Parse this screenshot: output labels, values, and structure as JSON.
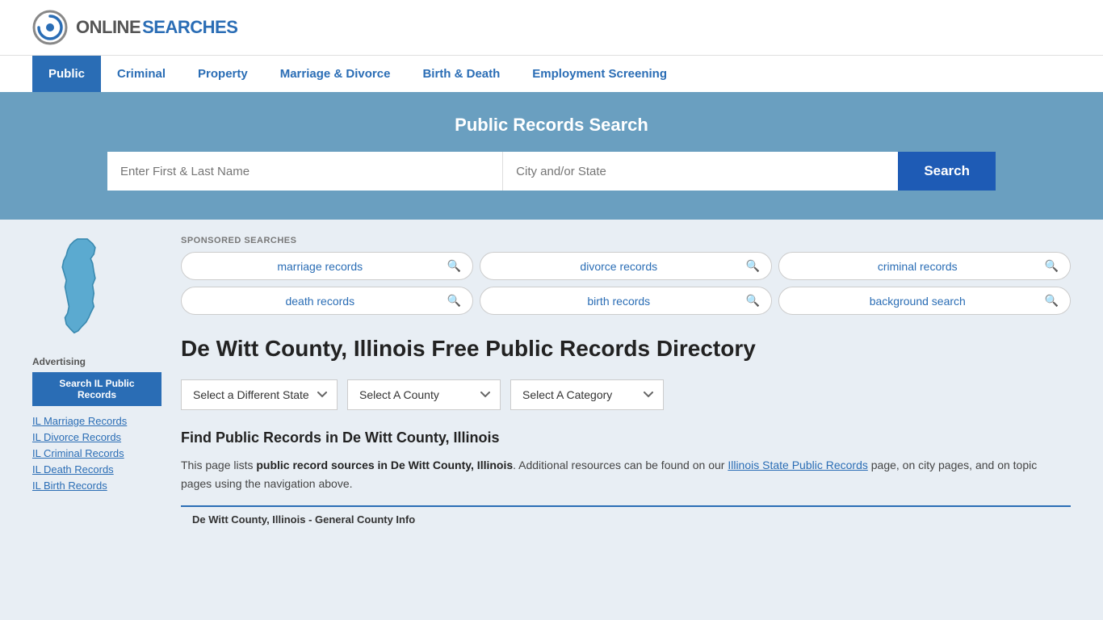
{
  "logo": {
    "online": "ONLINE",
    "searches": "SEARCHES"
  },
  "nav": {
    "items": [
      {
        "label": "Public",
        "active": true
      },
      {
        "label": "Criminal",
        "active": false
      },
      {
        "label": "Property",
        "active": false
      },
      {
        "label": "Marriage & Divorce",
        "active": false
      },
      {
        "label": "Birth & Death",
        "active": false
      },
      {
        "label": "Employment Screening",
        "active": false
      }
    ]
  },
  "hero": {
    "title": "Public Records Search",
    "name_placeholder": "Enter First & Last Name",
    "location_placeholder": "City and/or State",
    "search_button": "Search"
  },
  "sponsored": {
    "label": "SPONSORED SEARCHES",
    "items": [
      "marriage records",
      "divorce records",
      "criminal records",
      "death records",
      "birth records",
      "background search"
    ]
  },
  "page": {
    "title": "De Witt County, Illinois Free Public Records Directory",
    "dropdowns": {
      "state": "Select a Different State",
      "county": "Select A County",
      "category": "Select A Category"
    },
    "find_title": "Find Public Records in De Witt County, Illinois",
    "find_text_1": "This page lists ",
    "find_bold": "public record sources in De Witt County, Illinois",
    "find_text_2": ". Additional resources can be found on our ",
    "find_link": "Illinois State Public Records",
    "find_text_3": " page, on city pages, and on topic pages using the navigation above.",
    "county_info_bar": "De Witt County, Illinois - General County Info"
  },
  "sidebar": {
    "advertising_label": "Advertising",
    "ad_button": "Search IL Public Records",
    "links": [
      "IL Marriage Records",
      "IL Divorce Records",
      "IL Criminal Records",
      "IL Death Records",
      "IL Birth Records"
    ]
  }
}
